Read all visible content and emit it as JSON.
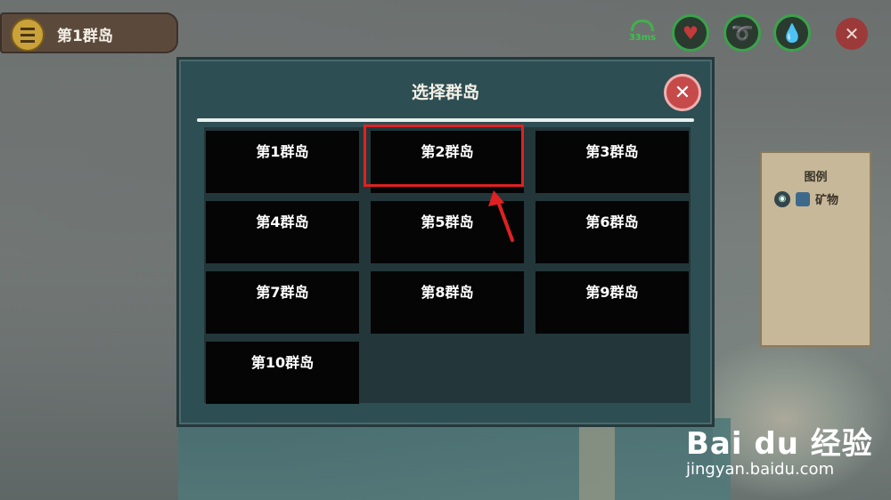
{
  "header": {
    "current_island": "第1群岛"
  },
  "hud": {
    "ping": "33ms"
  },
  "legend": {
    "title": "图例",
    "items": [
      {
        "label": "矿物"
      }
    ]
  },
  "dialog": {
    "title": "选择群岛",
    "islands": [
      "第1群岛",
      "第2群岛",
      "第3群岛",
      "第4群岛",
      "第5群岛",
      "第6群岛",
      "第7群岛",
      "第8群岛",
      "第9群岛",
      "第10群岛"
    ],
    "highlighted_index": 1
  },
  "watermark": {
    "brand": "Bai du 经验",
    "url": "jingyan.baidu.com"
  },
  "colors": {
    "dialog_bg": "#2d4e52",
    "highlight": "#e02121",
    "hud_ring": "#3aa34a"
  }
}
